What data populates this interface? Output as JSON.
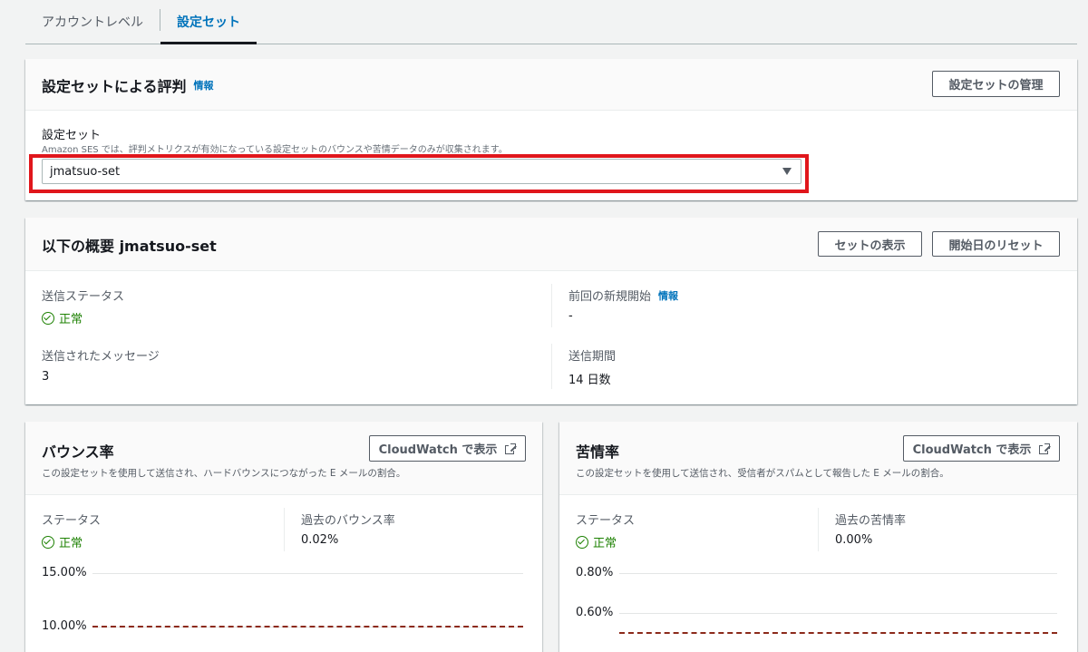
{
  "tabs": [
    {
      "label": "アカウントレベル",
      "active": false
    },
    {
      "label": "設定セット",
      "active": true
    }
  ],
  "reputation": {
    "title": "設定セットによる評判",
    "info": "情報",
    "manage_button": "設定セットの管理",
    "field_label": "設定セット",
    "field_desc": "Amazon SES では、評判メトリクスが有効になっている設定セットのバウンスや苦情データのみが収集されます。",
    "selected": "jmatsuo-set"
  },
  "summary": {
    "title": "以下の概要 jmatsuo-set",
    "view_button": "セットの表示",
    "reset_button": "開始日のリセット",
    "send_status_label": "送信ステータス",
    "send_status_value": "正常",
    "last_restart_label": "前回の新規開始",
    "last_restart_info": "情報",
    "last_restart_value": "-",
    "messages_label": "送信されたメッセージ",
    "messages_value": "3",
    "period_label": "送信期間",
    "period_value": "14 日数"
  },
  "bounce": {
    "title": "バウンス率",
    "cw_button": "CloudWatch で表示",
    "desc": "この設定セットを使用して送信され、ハードバウンスにつながった E メールの割合。",
    "status_label": "ステータス",
    "status_value": "正常",
    "hist_label": "過去のバウンス率",
    "hist_value": "0.02%"
  },
  "complaint": {
    "title": "苦情率",
    "cw_button": "CloudWatch で表示",
    "desc": "この設定セットを使用して送信され、受信者がスパムとして報告した E メールの割合。",
    "status_label": "ステータス",
    "status_value": "正常",
    "hist_label": "過去の苦情率",
    "hist_value": "0.00%"
  },
  "chart_data": [
    {
      "type": "line",
      "title": "",
      "y_ticks": [
        "15.00%",
        "10.00%"
      ],
      "series": [
        {
          "name": "",
          "values": []
        }
      ],
      "threshold": 10,
      "ylabel": "",
      "xlabel": ""
    },
    {
      "type": "line",
      "title": "",
      "y_ticks": [
        "0.80%",
        "0.60%"
      ],
      "series": [
        {
          "name": "",
          "values": []
        }
      ],
      "threshold": 0.5,
      "ylabel": "",
      "xlabel": ""
    }
  ],
  "colors": {
    "link": "#0073bb",
    "success": "#1d8102",
    "highlight": "#e0161b",
    "threshold": "#8c2a1b"
  }
}
